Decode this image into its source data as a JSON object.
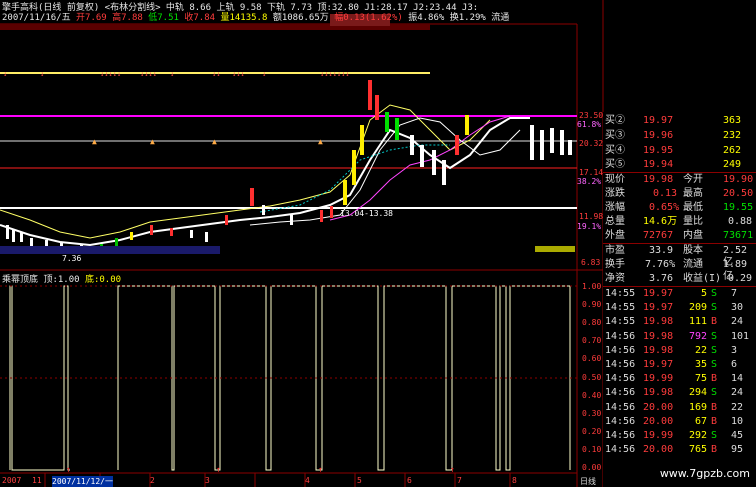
{
  "header": {
    "line1": "擎手高科(日线 前复权) <布林分割线> 中轨 8.66 上轨 9.58 下轨 7.73 顶:32.80 J1:28.17 J2:23.44 J3:",
    "line2_date": "2007/11/16/五",
    "line2_open": "开7.69",
    "line2_high": "高7.88",
    "line2_low": "低7.51",
    "line2_close": "收7.84",
    "line2_vol": "量14135.8",
    "line2_amt": "额1086.65万",
    "line2_chg": "幅0.13(1.62%)",
    "line2_amp": "振4.86%",
    "line2_turn": "换1.29%",
    "line2_extra": "流通"
  },
  "price_labels": {
    "p1": "23.50",
    "p1b": "61.8%",
    "p2": "20.32",
    "p3": "17.14",
    "p3b": "38.2%",
    "p4": "11.98",
    "p4b": "19.1%",
    "p5": "6.83",
    "range_label": "13.04-13.38",
    "low_label": "7.36"
  },
  "indicator": {
    "name": "乘幂顶底",
    "top_label": "顶:1.00",
    "bottom_label": "底:0.00",
    "axis": [
      "1.00",
      "0.90",
      "0.80",
      "0.70",
      "0.60",
      "0.50",
      "0.40",
      "0.30",
      "0.20",
      "0.10",
      "0.00"
    ]
  },
  "xaxis": {
    "labels": [
      "2007",
      "11",
      "2007/11/12/一",
      "2",
      "3",
      "4",
      "5",
      "6",
      "7",
      "8"
    ],
    "day_label": "日线"
  },
  "quotes": {
    "asks": [
      {
        "label": "买②",
        "price": "19.97",
        "vol": "363"
      },
      {
        "label": "买③",
        "price": "19.96",
        "vol": "232"
      },
      {
        "label": "买④",
        "price": "19.95",
        "vol": "262"
      },
      {
        "label": "买⑤",
        "price": "19.94",
        "vol": "249"
      }
    ],
    "stats": [
      {
        "l1": "现价",
        "v1": "19.98",
        "l2": "今开",
        "v2": "19.90"
      },
      {
        "l1": "涨跌",
        "v1": "0.13",
        "l2": "最高",
        "v2": "20.50"
      },
      {
        "l1": "涨幅",
        "v1": "0.65%",
        "l2": "最低",
        "v2": "19.55"
      },
      {
        "l1": "总量",
        "v1": "14.6万",
        "l2": "量比",
        "v2": "0.88"
      },
      {
        "l1": "外盘",
        "v1": "72767",
        "l2": "内盘",
        "v2": "73671"
      }
    ],
    "stats2": [
      {
        "l1": "市盈",
        "v1": "33.9",
        "l2": "股本",
        "v2": "2.52亿"
      },
      {
        "l1": "换手",
        "v1": "7.76%",
        "l2": "流通",
        "v2": "1.89亿"
      },
      {
        "l1": "净资",
        "v1": "3.76",
        "l2": "收益(I)",
        "v2": "0.29"
      }
    ],
    "ticks": [
      {
        "t": "14:55",
        "p": "19.97",
        "v": "5",
        "s": "S",
        "n": "7"
      },
      {
        "t": "14:55",
        "p": "19.97",
        "v": "209",
        "s": "S",
        "n": "30"
      },
      {
        "t": "14:55",
        "p": "19.98",
        "v": "111",
        "s": "B",
        "n": "24"
      },
      {
        "t": "14:56",
        "p": "19.98",
        "v": "792",
        "s": "S",
        "n": "101"
      },
      {
        "t": "14:56",
        "p": "19.98",
        "v": "22",
        "s": "S",
        "n": "3"
      },
      {
        "t": "14:56",
        "p": "19.97",
        "v": "35",
        "s": "S",
        "n": "6"
      },
      {
        "t": "14:56",
        "p": "19.99",
        "v": "75",
        "s": "B",
        "n": "14"
      },
      {
        "t": "14:56",
        "p": "19.98",
        "v": "294",
        "s": "S",
        "n": "24"
      },
      {
        "t": "14:56",
        "p": "20.00",
        "v": "169",
        "s": "B",
        "n": "22"
      },
      {
        "t": "14:56",
        "p": "20.00",
        "v": "67",
        "s": "B",
        "n": "10"
      },
      {
        "t": "14:56",
        "p": "19.99",
        "v": "292",
        "s": "S",
        "n": "45"
      },
      {
        "t": "14:56",
        "p": "20.00",
        "v": "765",
        "s": "B",
        "n": "95"
      }
    ]
  },
  "watermark": "www.7gpzb.com",
  "colors": {
    "up": "#ff3c3c",
    "down": "#00e0e0",
    "yellow": "#ffff00",
    "magenta": "#ff00ff",
    "white": "#ffffff"
  }
}
